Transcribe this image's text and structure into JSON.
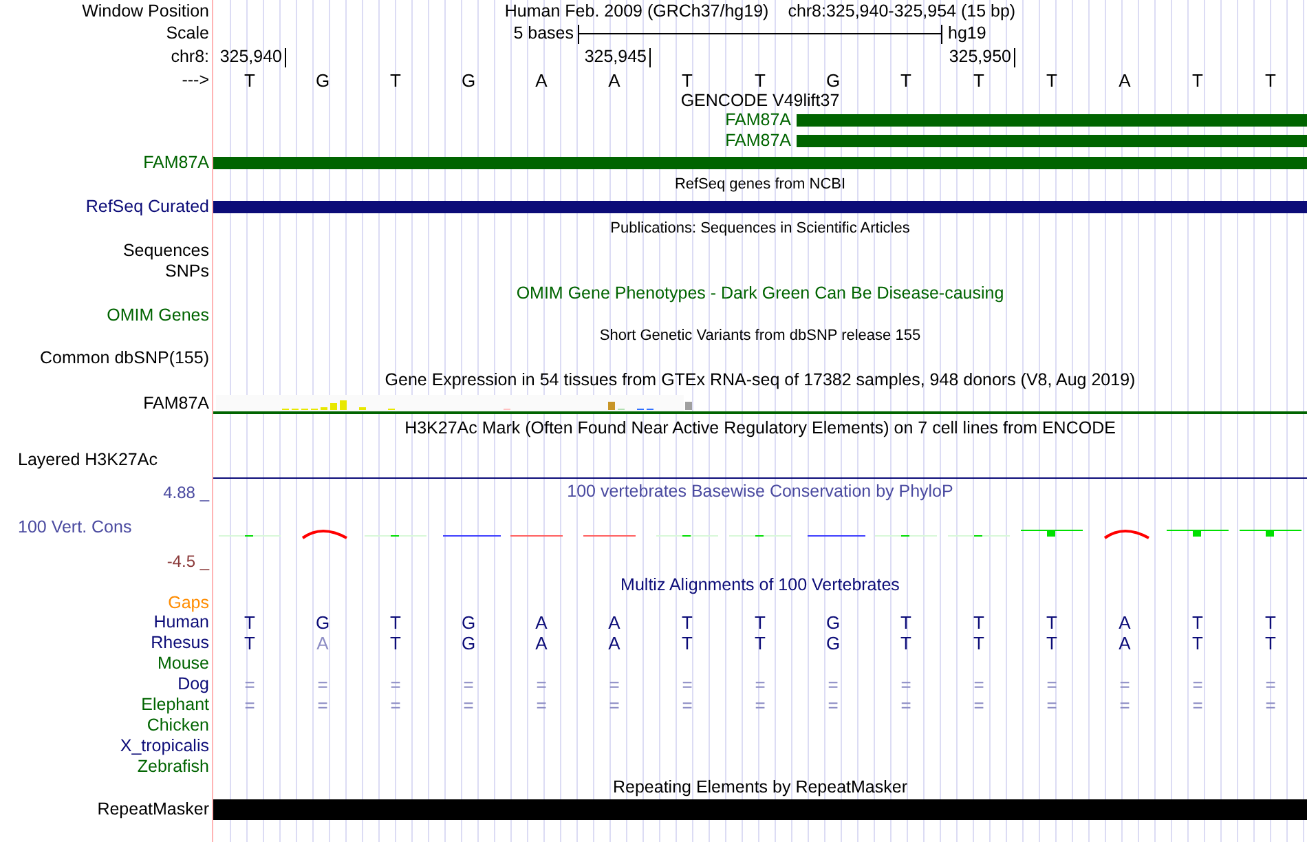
{
  "header": {
    "window_position_label": "Window Position",
    "assembly": "Human Feb. 2009 (GRCh37/hg19)",
    "position": "chr8:325,940-325,954 (15 bp)",
    "scale_label": "Scale",
    "scale_text": "5 bases",
    "db": "hg19",
    "chrom_label": "chr8:",
    "ticks": [
      "325,940",
      "325,945",
      "325,950"
    ],
    "strand_label": "--->"
  },
  "bases": [
    "T",
    "G",
    "T",
    "G",
    "A",
    "A",
    "T",
    "T",
    "G",
    "T",
    "T",
    "T",
    "A",
    "T",
    "T"
  ],
  "tracks": [
    {
      "kind": "title",
      "text": "GENCODE V49lift37"
    },
    {
      "kind": "transcript",
      "text": "FAM87A",
      "color": "#006400"
    },
    {
      "kind": "transcript",
      "text": "FAM87A",
      "color": "#006400"
    },
    {
      "kind": "gene",
      "label": "FAM87A",
      "color": "#006400"
    },
    {
      "kind": "note",
      "text": "RefSeq genes from NCBI"
    },
    {
      "kind": "gene",
      "label": "RefSeq Curated",
      "color": "#0c0c78"
    },
    {
      "kind": "note",
      "text": "Publications: Sequences in Scientific Articles"
    },
    {
      "kind": "label",
      "label": "Sequences"
    },
    {
      "kind": "label",
      "label": "SNPs"
    },
    {
      "kind": "title",
      "text": "OMIM Gene Phenotypes - Dark Green Can Be Disease-causing",
      "color": "#006400"
    },
    {
      "kind": "label",
      "label": "OMIM Genes",
      "color": "#006400"
    },
    {
      "kind": "note",
      "text": "Short Genetic Variants from dbSNP release 155"
    },
    {
      "kind": "label",
      "label": "Common dbSNP(155)"
    },
    {
      "kind": "title",
      "text": "Gene Expression in 54 tissues from GTEx RNA-seq of 17382 samples, 948 donors (V8, Aug 2019)"
    },
    {
      "kind": "expression",
      "label": "FAM87A"
    },
    {
      "kind": "title",
      "text": "H3K27Ac Mark (Often Found Near Active Regulatory Elements) on 7 cell lines from ENCODE"
    },
    {
      "kind": "layered",
      "label": "Layered H3K27Ac"
    }
  ],
  "conservation": {
    "max": "4.88 _",
    "label": "100 Vert. Cons",
    "min": "-4.5 _",
    "title": "100 vertebrates Basewise Conservation by PhyloP"
  },
  "alignment": {
    "title": "Multiz Alignments of 100 Vertebrates",
    "species": [
      {
        "name": "Gaps",
        "color": "#ff8c00",
        "kind": "empty"
      },
      {
        "name": "Human",
        "color": "#0c0c78",
        "kind": "bases",
        "bases": [
          {
            "text": "T",
            "faded": false
          },
          {
            "text": "G",
            "faded": false
          },
          {
            "text": "T",
            "faded": false
          },
          {
            "text": "G",
            "faded": false
          },
          {
            "text": "A",
            "faded": false
          },
          {
            "text": "A",
            "faded": false
          },
          {
            "text": "T",
            "faded": false
          },
          {
            "text": "T",
            "faded": false
          },
          {
            "text": "G",
            "faded": false
          },
          {
            "text": "T",
            "faded": false
          },
          {
            "text": "T",
            "faded": false
          },
          {
            "text": "T",
            "faded": false
          },
          {
            "text": "A",
            "faded": false
          },
          {
            "text": "T",
            "faded": false
          },
          {
            "text": "T",
            "faded": false
          }
        ]
      },
      {
        "name": "Rhesus",
        "color": "#0c0c78",
        "kind": "bases",
        "bases": [
          {
            "text": "T",
            "faded": false
          },
          {
            "text": "A",
            "faded": true
          },
          {
            "text": "T",
            "faded": false
          },
          {
            "text": "G",
            "faded": false
          },
          {
            "text": "A",
            "faded": false
          },
          {
            "text": "A",
            "faded": false
          },
          {
            "text": "T",
            "faded": false
          },
          {
            "text": "T",
            "faded": false
          },
          {
            "text": "G",
            "faded": false
          },
          {
            "text": "T",
            "faded": false
          },
          {
            "text": "T",
            "faded": false
          },
          {
            "text": "T",
            "faded": false
          },
          {
            "text": "A",
            "faded": false
          },
          {
            "text": "T",
            "faded": false
          },
          {
            "text": "T",
            "faded": false
          }
        ]
      },
      {
        "name": "Mouse",
        "color": "#006400",
        "kind": "empty"
      },
      {
        "name": "Dog",
        "color": "#0c0c78",
        "kind": "bases",
        "bases": [
          {
            "text": "=",
            "faded": true
          },
          {
            "text": "=",
            "faded": true
          },
          {
            "text": "=",
            "faded": true
          },
          {
            "text": "=",
            "faded": true
          },
          {
            "text": "=",
            "faded": true
          },
          {
            "text": "=",
            "faded": true
          },
          {
            "text": "=",
            "faded": true
          },
          {
            "text": "=",
            "faded": true
          },
          {
            "text": "=",
            "faded": true
          },
          {
            "text": "=",
            "faded": true
          },
          {
            "text": "=",
            "faded": true
          },
          {
            "text": "=",
            "faded": true
          },
          {
            "text": "=",
            "faded": true
          },
          {
            "text": "=",
            "faded": true
          },
          {
            "text": "=",
            "faded": true
          }
        ]
      },
      {
        "name": "Elephant",
        "color": "#006400",
        "kind": "bases",
        "bases": [
          {
            "text": "=",
            "faded": true
          },
          {
            "text": "=",
            "faded": true
          },
          {
            "text": "=",
            "faded": true
          },
          {
            "text": "=",
            "faded": true
          },
          {
            "text": "=",
            "faded": true
          },
          {
            "text": "=",
            "faded": true
          },
          {
            "text": "=",
            "faded": true
          },
          {
            "text": "=",
            "faded": true
          },
          {
            "text": "=",
            "faded": true
          },
          {
            "text": "=",
            "faded": true
          },
          {
            "text": "=",
            "faded": true
          },
          {
            "text": "=",
            "faded": true
          },
          {
            "text": "=",
            "faded": true
          },
          {
            "text": "=",
            "faded": true
          },
          {
            "text": "=",
            "faded": true
          }
        ]
      },
      {
        "name": "Chicken",
        "color": "#006400",
        "kind": "empty"
      },
      {
        "name": "X_tropicalis",
        "color": "#0c0c78",
        "kind": "empty"
      },
      {
        "name": "Zebrafish",
        "color": "#006400",
        "kind": "empty"
      }
    ]
  },
  "repeats": {
    "title": "Repeating Elements by RepeatMasker",
    "label": "RepeatMasker"
  }
}
